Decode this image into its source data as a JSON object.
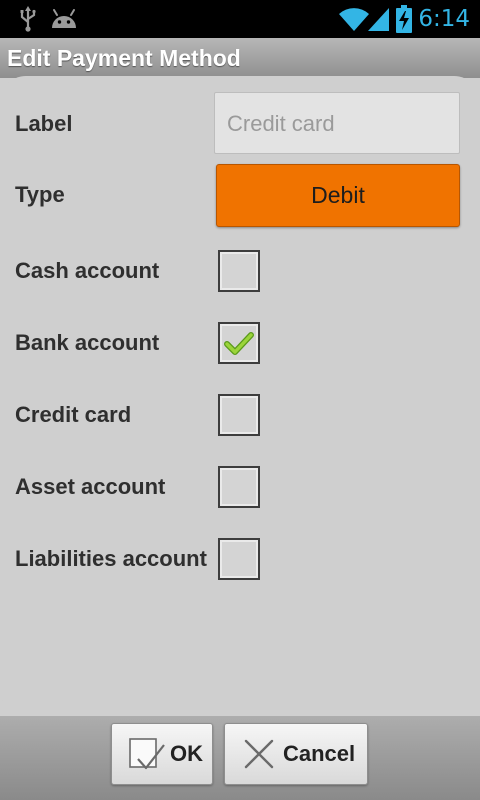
{
  "status_bar": {
    "time": "6:14",
    "left_icons": [
      "usb-icon",
      "android-icon"
    ],
    "right_icons": [
      "wifi-icon",
      "signal-icon",
      "battery-charging-icon"
    ],
    "time_color": "#33b5e5"
  },
  "title_bar": {
    "title": "Edit Payment Method"
  },
  "form": {
    "label_field": {
      "label": "Label",
      "placeholder": "Credit card"
    },
    "type_field": {
      "label": "Type",
      "value": "Debit",
      "color": "#f07300"
    },
    "checkboxes": [
      {
        "label": "Cash account",
        "checked": false
      },
      {
        "label": "Bank account",
        "checked": true
      },
      {
        "label": "Credit card",
        "checked": false
      },
      {
        "label": "Asset account",
        "checked": false
      },
      {
        "label": "Liabilities account",
        "checked": false
      }
    ]
  },
  "buttons": {
    "ok": {
      "label": "OK",
      "icon": "checkbox-check-icon"
    },
    "cancel": {
      "label": "Cancel",
      "icon": "x-cross-icon"
    }
  }
}
